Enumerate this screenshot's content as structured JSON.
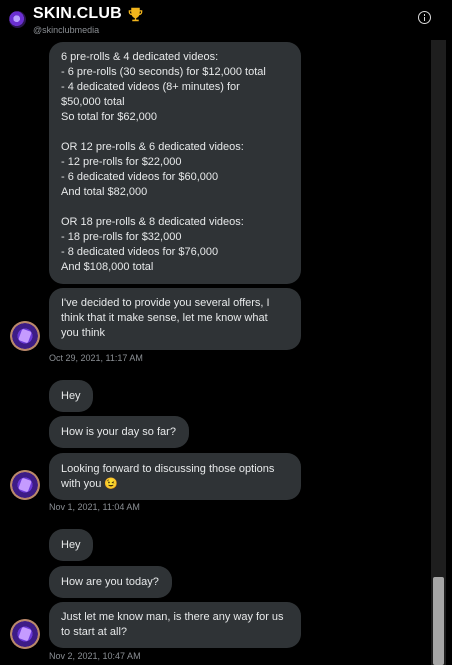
{
  "header": {
    "title": "SKIN.CLUB",
    "trophy_emoji": "🏆",
    "handle": "@skinclubmedia"
  },
  "messages": [
    {
      "lines": [
        "6 pre-rolls & 4 dedicated videos:",
        "- 6 pre-rolls (30 seconds) for $12,000 total",
        "- 4 dedicated videos (8+ minutes) for",
        "$50,000 total",
        "So total for $62,000",
        "",
        "OR 12 pre-rolls & 6 dedicated videos:",
        "- 12 pre-rolls for $22,000",
        "- 6 dedicated videos for $60,000",
        "And total $82,000",
        "",
        "OR 18 pre-rolls & 8 dedicated videos:",
        "- 18 pre-rolls for $32,000",
        "- 8 dedicated videos for $76,000",
        "And $108,000 total"
      ]
    },
    {
      "lines": [
        "I've decided to provide you several offers, I",
        "think that it make sense, let me know what",
        "you think"
      ]
    },
    {
      "lines": [
        "Hey"
      ]
    },
    {
      "lines": [
        "How is your day so far?"
      ]
    },
    {
      "lines": [
        "Looking forward to discussing those options",
        "with you 😉"
      ]
    },
    {
      "lines": [
        "Hey"
      ]
    },
    {
      "lines": [
        "How are you today?"
      ]
    },
    {
      "lines": [
        "Just let me know man, is there any way for us",
        "to start at all?"
      ]
    }
  ],
  "timestamps": [
    "Oct 29, 2021, 11:17 AM",
    "Nov 1, 2021, 11:04 AM",
    "Nov 2, 2021, 10:47 AM"
  ],
  "colors": {
    "background": "#000000",
    "bubble": "#2f3336",
    "text": "#e7e9ea",
    "muted": "#8b8f94"
  }
}
